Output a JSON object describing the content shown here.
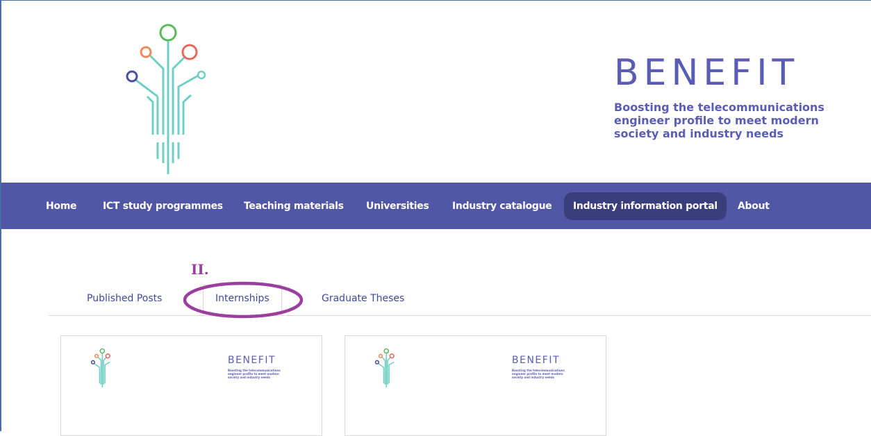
{
  "header": {
    "brand_title": "BENEFIT",
    "brand_tagline": "Boosting the telecommunications engineer profile to meet modern society and industry needs",
    "logo_icon": "circuit-tree-logo-icon"
  },
  "nav": {
    "items": [
      {
        "label": "Home"
      },
      {
        "label": "ICT study programmes"
      },
      {
        "label": "Teaching materials"
      },
      {
        "label": "Universities"
      },
      {
        "label": "Industry catalogue"
      },
      {
        "label": "Industry information portal",
        "active": true
      },
      {
        "label": "About"
      }
    ]
  },
  "annotation": {
    "marker": "II."
  },
  "tabs": [
    {
      "label": "Published Posts"
    },
    {
      "label": "Internships",
      "selected": true
    },
    {
      "label": "Graduate Theses"
    }
  ],
  "cards": [
    {
      "brand_title": "BENEFIT",
      "brand_tagline": "Boosting the telecommunications engineer profile to meet modern society and industry needs"
    },
    {
      "brand_title": "BENEFIT",
      "brand_tagline": "Boosting the telecommunications engineer profile to meet modern society and industry needs"
    }
  ],
  "colors": {
    "brand": "#5a5db5",
    "nav_bg": "#5157a4",
    "nav_active_bg": "#3a3e7c",
    "annotation": "#9b3f9e",
    "logo_teal": "#6fcfc4",
    "logo_green": "#5cb85c",
    "logo_red": "#e8665a",
    "logo_orange": "#f08a5d",
    "logo_navy": "#4a4ea0"
  }
}
